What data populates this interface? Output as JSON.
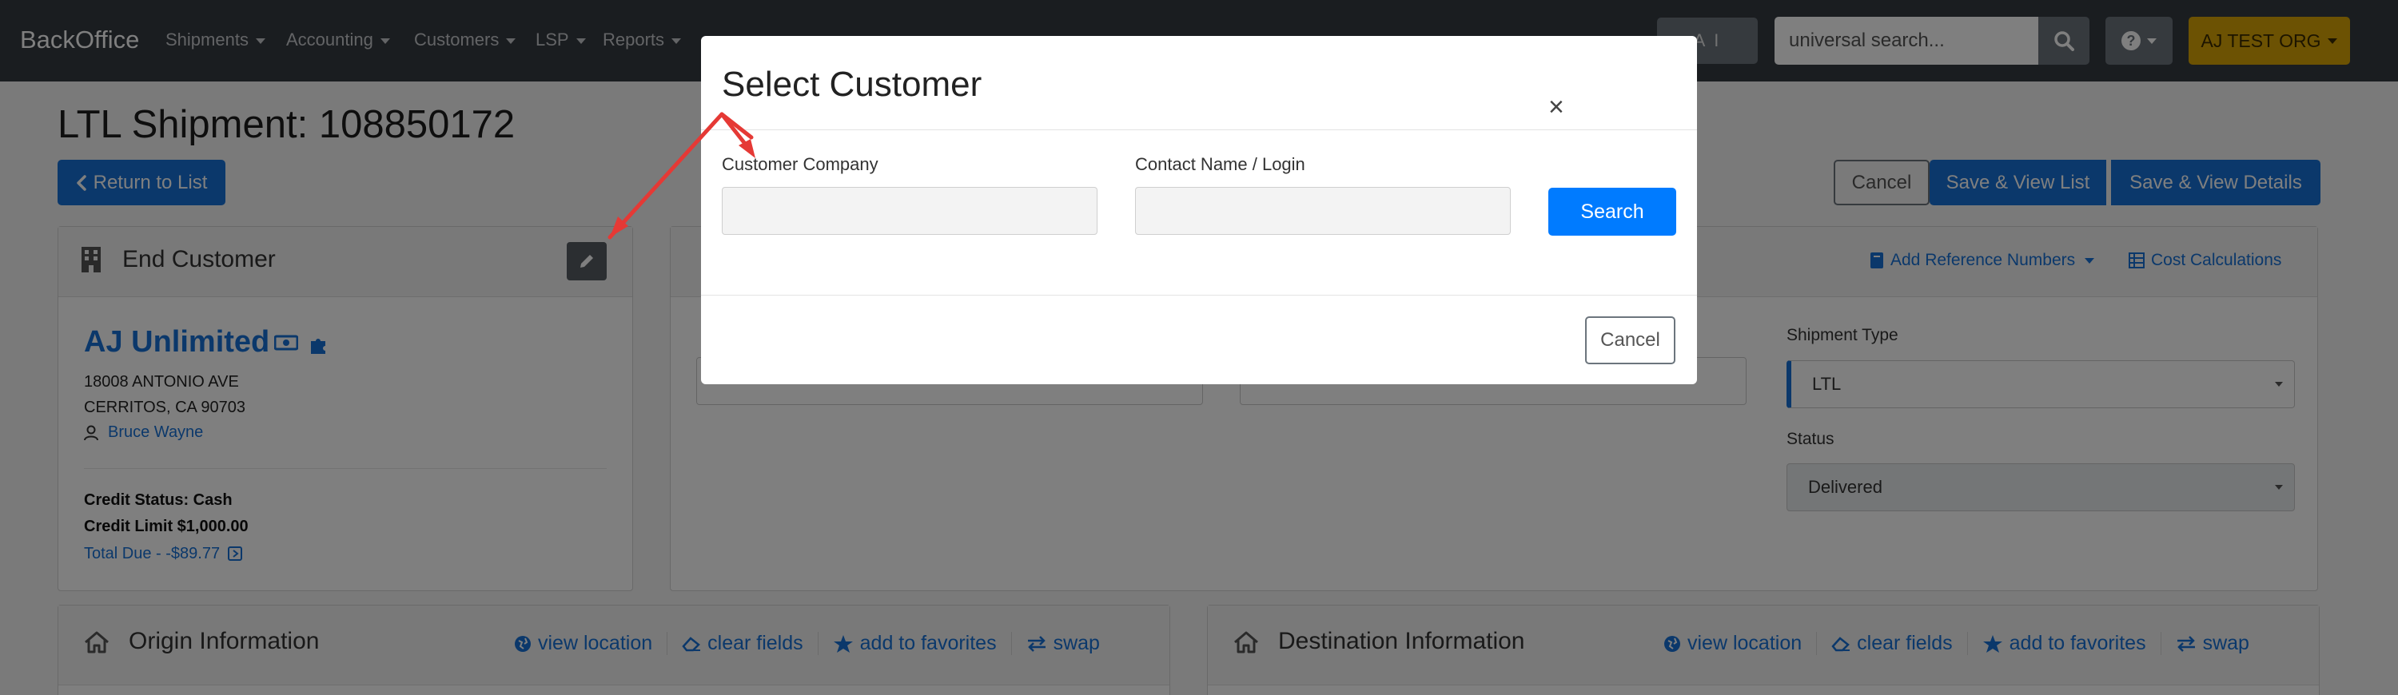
{
  "navbar": {
    "brand": "BackOffice",
    "items": [
      {
        "label": "Shipments"
      },
      {
        "label": "Accounting"
      },
      {
        "label": "Customers"
      },
      {
        "label": "LSP"
      },
      {
        "label": "Reports"
      }
    ],
    "ai_label": "A I",
    "search_placeholder": "universal search...",
    "org_label": "AJ TEST ORG"
  },
  "page": {
    "title": "LTL Shipment: 108850172",
    "return_label": "Return to List",
    "cancel_label": "Cancel",
    "save_list_label": "Save & View List",
    "save_details_label": "Save & View Details"
  },
  "end_customer": {
    "header": "End Customer",
    "name": "AJ Unlimited",
    "address_line1": "18008 ANTONIO AVE",
    "address_line2": "CERRITOS, CA 90703",
    "contact": "Bruce Wayne",
    "credit_status": "Credit Status: Cash",
    "credit_limit": "Credit Limit $1,000.00",
    "total_due": "Total Due - -$89.77"
  },
  "shipment_panel": {
    "add_reference": "Add Reference Numbers",
    "cost_calculations": "Cost Calculations",
    "shipment_type_label": "Shipment Type",
    "shipment_type_value": "LTL",
    "status_label": "Status",
    "status_value": "Delivered"
  },
  "origin": {
    "header": "Origin Information",
    "links": [
      "view location",
      "clear fields",
      "add to favorites",
      "swap"
    ]
  },
  "destination": {
    "header": "Destination Information",
    "links": [
      "view location",
      "clear fields",
      "add to favorites",
      "swap"
    ]
  },
  "modal": {
    "title": "Select Customer",
    "close": "×",
    "company_label": "Customer Company",
    "contact_label": "Contact Name / Login",
    "search_label": "Search",
    "cancel_label": "Cancel"
  },
  "colors": {
    "navbar": "#343a40",
    "primary": "#1771d6",
    "org_button": "#d9a406",
    "annotation_arrow": "#e53935"
  }
}
